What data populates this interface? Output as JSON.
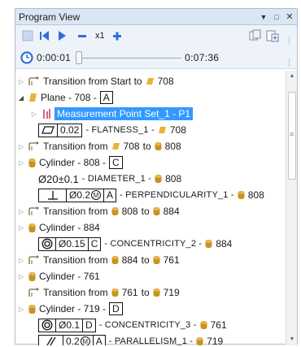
{
  "panel": {
    "title": "Program View",
    "title_icons": [
      "dropdown-icon",
      "float-icon",
      "close-icon"
    ]
  },
  "toolbar": {
    "speed_label": "x1",
    "icons": [
      "stop-icon",
      "step-back-icon",
      "play-icon",
      "slower-icon",
      "faster-icon",
      "copy-icon",
      "paste-icon"
    ]
  },
  "timeline": {
    "current_time": "0:00:01",
    "total_time": "0:07:36",
    "position": 0.0
  },
  "tree": {
    "r0": {
      "text": "Transition from Start to",
      "target": "708"
    },
    "r1": {
      "label": "Plane - 708 -",
      "datum": "A"
    },
    "r2": {
      "text": "Measurement Point Set_1 - P1"
    },
    "r3": {
      "tol": "0.02",
      "text": "- FLATNESS_1 -",
      "ref": "708"
    },
    "r4": {
      "text_a": "Transition from",
      "a": "708",
      "to": "to",
      "b": "808"
    },
    "r5": {
      "label": "Cylinder - 808 -",
      "datum": "C"
    },
    "r6": {
      "dim": "Ø20±0.1",
      "text": "- DIAMETER_1 -",
      "ref": "808"
    },
    "r7": {
      "tol": "Ø0.2",
      "mod": "M",
      "datum": "A",
      "text": "- PERPENDICULARITY_1 -",
      "ref": "808"
    },
    "r8": {
      "text_a": "Transition from",
      "a": "808",
      "to": "to",
      "b": "884"
    },
    "r9": {
      "label": "Cylinder - 884"
    },
    "r10": {
      "tol": "Ø0.15",
      "datum": "C",
      "text": "- CONCENTRICITY_2 -",
      "ref": "884"
    },
    "r11": {
      "text_a": "Transition from",
      "a": "884",
      "to": "to",
      "b": "761"
    },
    "r12": {
      "label": "Cylinder - 761"
    },
    "r13": {
      "text_a": "Transition from",
      "a": "761",
      "to": "to",
      "b": "719"
    },
    "r14": {
      "label": "Cylinder - 719 -",
      "datum": "D"
    },
    "r15": {
      "tol": "Ø0.1",
      "datum": "D",
      "text": "- CONCENTRICITY_3 -",
      "ref": "761"
    },
    "r16": {
      "tol": "0.2",
      "mod": "M",
      "datum": "A",
      "text": "- PARALLELISM_1 -",
      "ref": "719"
    }
  },
  "colors": {
    "plane_icon": "#e8b33a",
    "cylinder_icon": "#c8921e",
    "selection": "#3399ff",
    "play_blue": "#2f6fd6"
  }
}
